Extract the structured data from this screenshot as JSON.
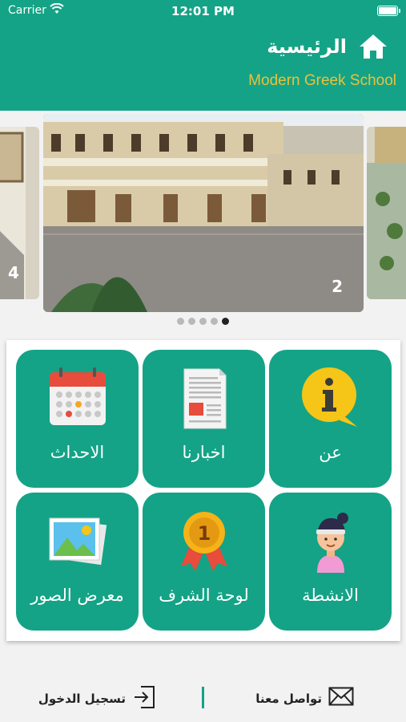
{
  "status_bar": {
    "carrier": "Carrier",
    "time": "12:01 PM"
  },
  "header": {
    "title": "الرئيسية",
    "subtitle": "Modern Greek School"
  },
  "carousel": {
    "left_number": "4",
    "main_number": "2",
    "dot_count": 5,
    "active_dot": 5
  },
  "grid": {
    "items": [
      {
        "label": "عن",
        "icon": "info-icon"
      },
      {
        "label": "اخبارنا",
        "icon": "news-document-icon"
      },
      {
        "label": "الاحداث",
        "icon": "calendar-icon"
      },
      {
        "label": "الانشطة",
        "icon": "activity-person-icon"
      },
      {
        "label": "لوحة الشرف",
        "icon": "medal-icon"
      },
      {
        "label": "معرض الصور",
        "icon": "photo-gallery-icon"
      }
    ]
  },
  "bottom_bar": {
    "contact_label": "تواصل معنا",
    "login_label": "تسجيل الدخول"
  },
  "colors": {
    "primary": "#14a386",
    "subtitle": "#e8c23c"
  }
}
